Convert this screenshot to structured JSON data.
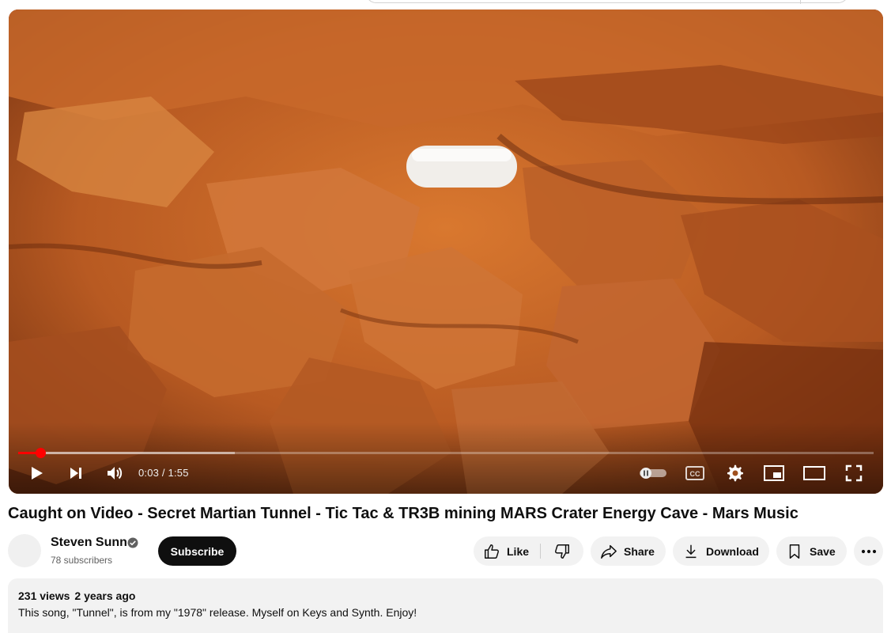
{
  "player": {
    "current_time": "0:03",
    "duration": "1:55",
    "time_separator": " / ",
    "progress_fraction": 0.026,
    "buffered_fraction": 0.253
  },
  "video": {
    "title": "Caught on Video - Secret Martian Tunnel - Tic Tac & TR3B mining MARS Crater Energy Cave - Mars Music"
  },
  "channel": {
    "name": "Steven Sunn",
    "subscribers": "78 subscribers",
    "subscribe_label": "Subscribe"
  },
  "actions": {
    "like_label": "Like",
    "share_label": "Share",
    "download_label": "Download",
    "save_label": "Save"
  },
  "description": {
    "views": "231 views",
    "age": "2 years ago",
    "text": "This song, \"Tunnel\", is from my \"1978\" release. Myself on Keys and Synth. Enjoy!",
    "more": "..."
  },
  "icons": {
    "play": "play-icon",
    "next": "next-icon",
    "volume": "volume-icon",
    "autoplay": "autoplay-toggle-icon",
    "cc": "captions-icon",
    "settings": "gear-icon",
    "miniplayer": "miniplayer-icon",
    "theater": "theater-icon",
    "fullscreen": "fullscreen-icon",
    "like": "thumbs-up-icon",
    "dislike": "thumbs-down-icon",
    "share": "share-icon",
    "download": "download-icon",
    "save": "bookmark-icon",
    "more": "more-dots-icon"
  },
  "colors": {
    "accent": "#ff0000",
    "button_bg": "#f2f2f2",
    "subscribe_bg": "#0f0f0f"
  }
}
